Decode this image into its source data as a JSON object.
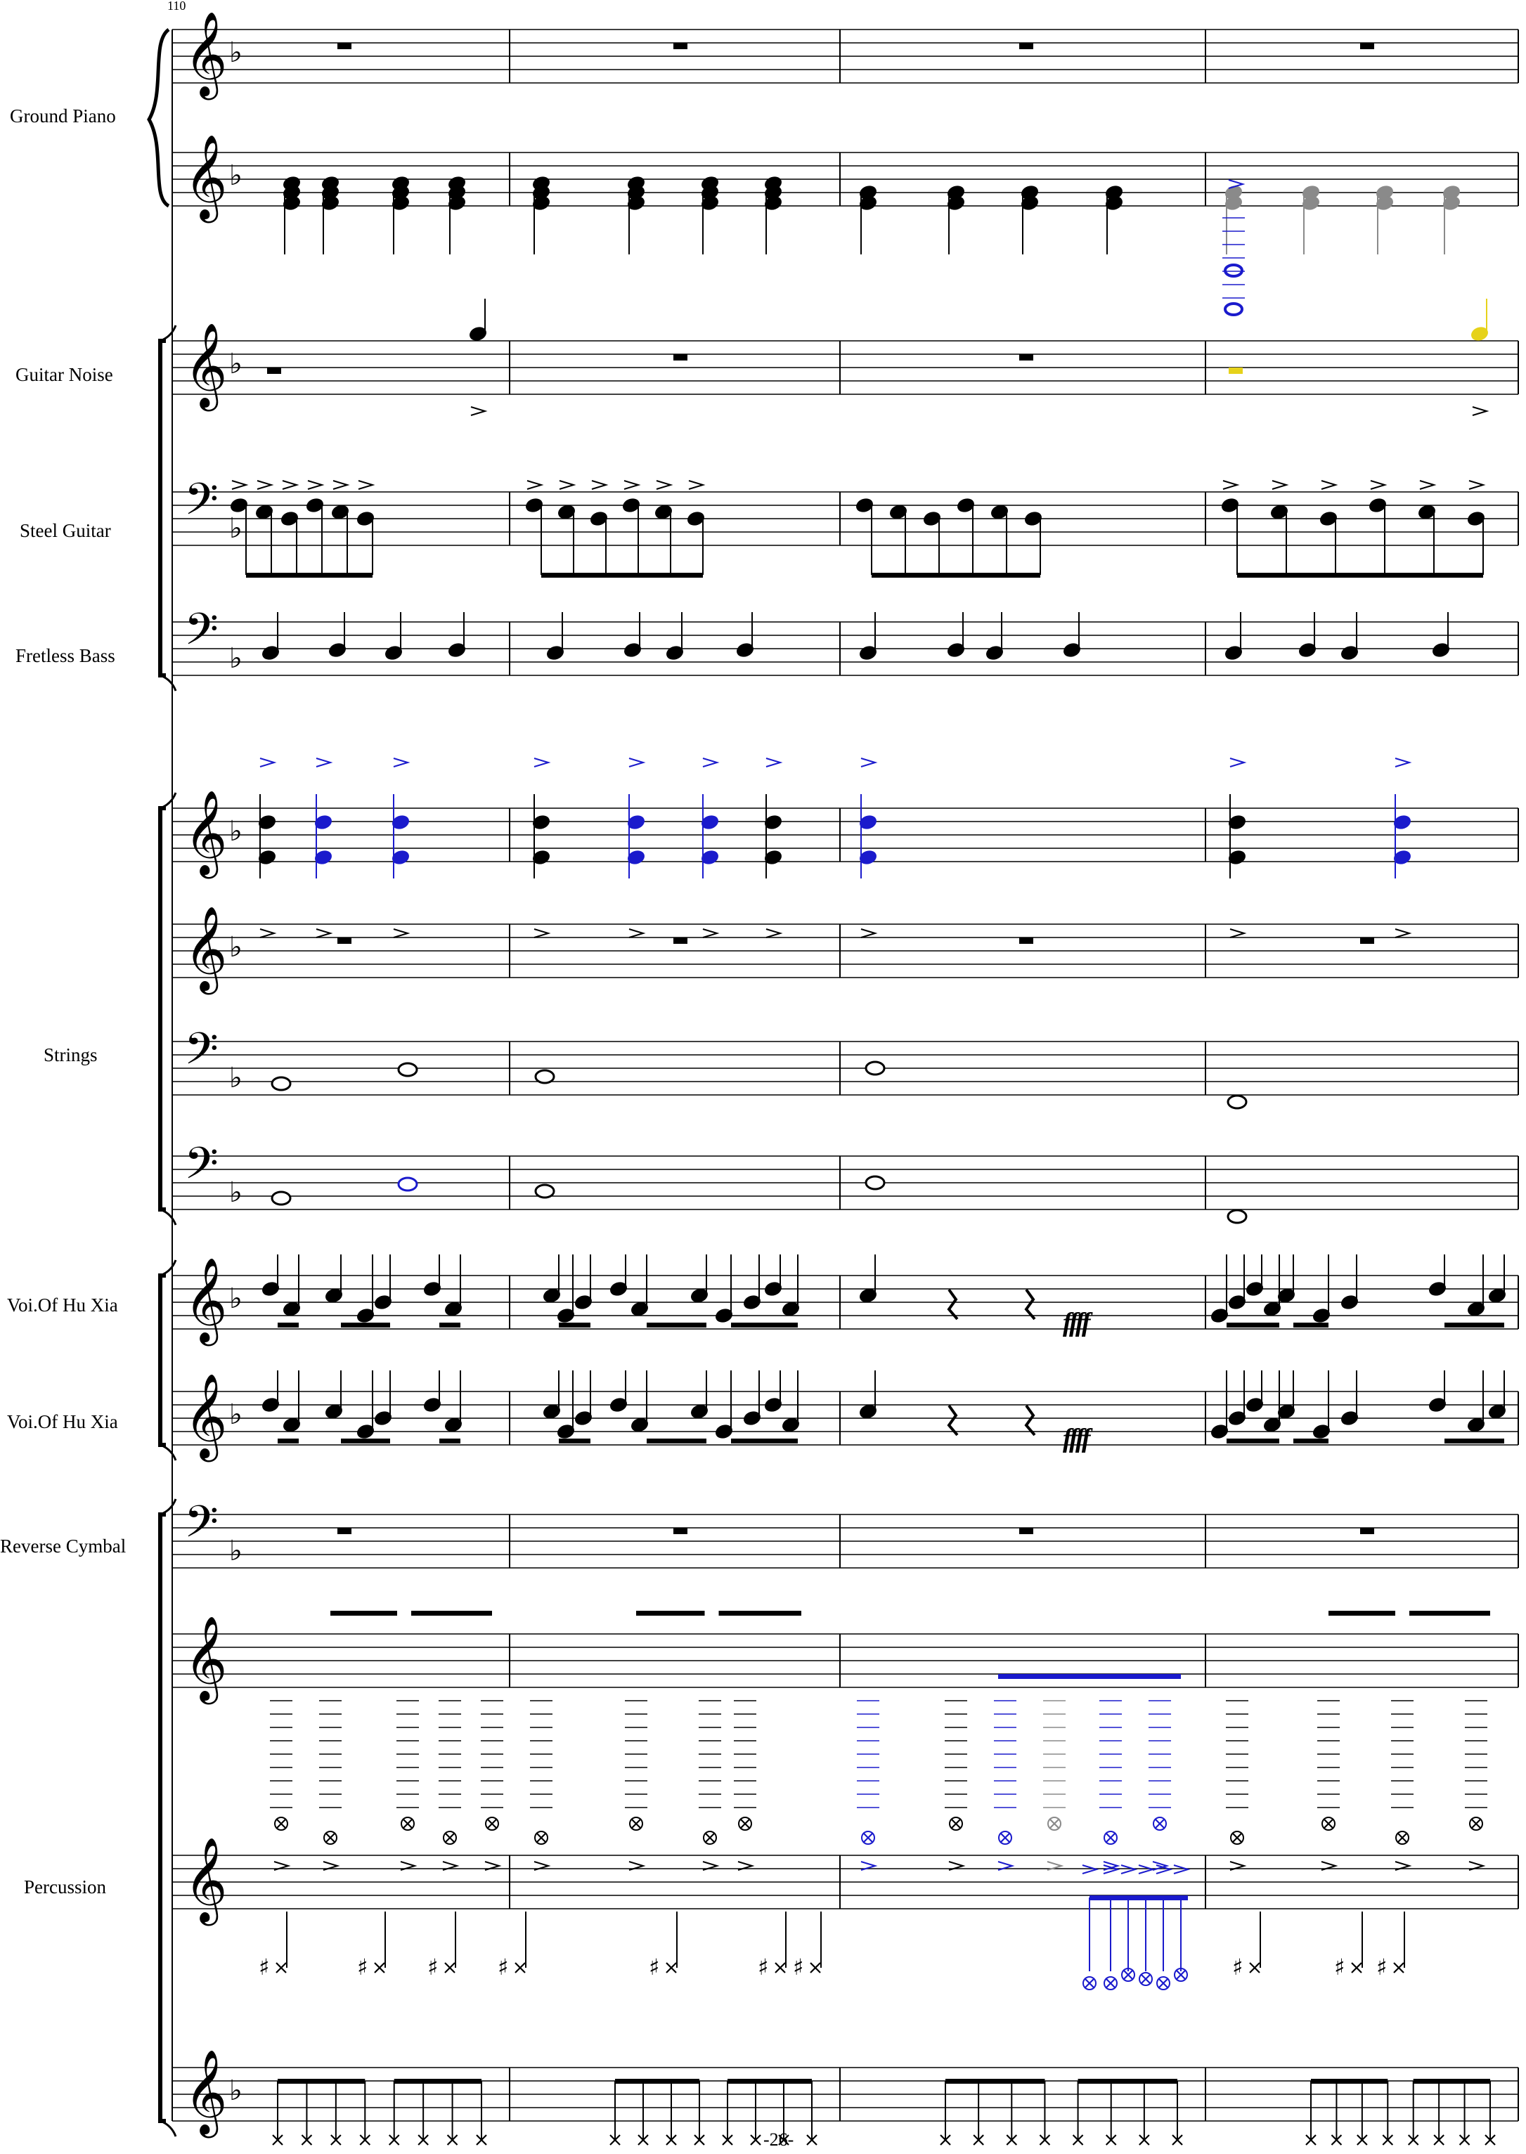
{
  "page": {
    "measure_number": "110",
    "page_number": "-26-"
  },
  "instruments": {
    "ground_piano": "Ground Piano",
    "guitar_noise": "Guitar Noise",
    "steel_guitar": "Steel Guitar",
    "fretless_bass": "Fretless Bass",
    "strings": "Strings",
    "voice_1": "Voi.Of Hu Xia",
    "voice_2": "Voi.Of Hu Xia",
    "reverse_cymbal": "Reverse Cymbal",
    "percussion": "Percussion"
  },
  "dynamics": {
    "voice_1": "ffff",
    "voice_2": "ffff"
  },
  "colors": {
    "ink": "#000000",
    "highlight_blue": "#1a1acc",
    "highlight_gray": "#8a8a8a",
    "highlight_yellow": "#e6d21a"
  }
}
